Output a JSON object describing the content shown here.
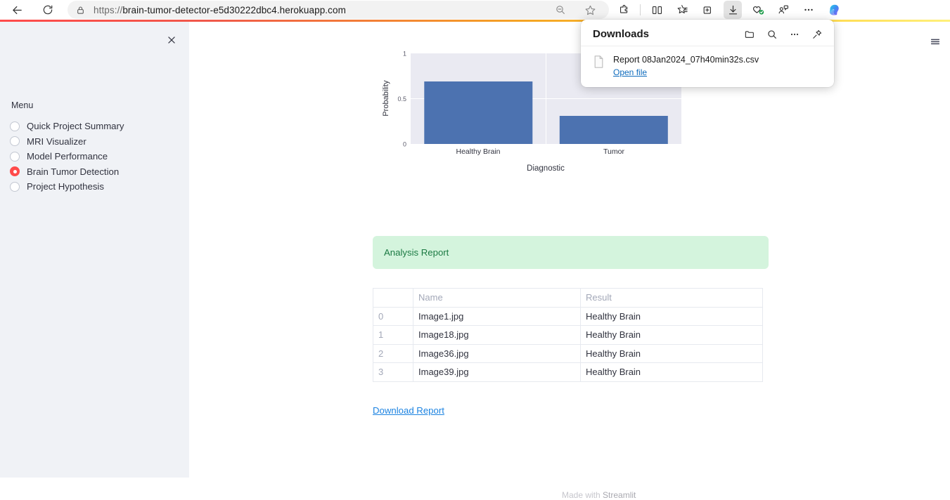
{
  "browser": {
    "url_scheme": "https://",
    "url_rest": "brain-tumor-detector-e5d30222dbc4.herokuapp.com",
    "url_full": "https://brain-tumor-detector-e5d30222dbc4.herokuapp.com",
    "back_icon": "back-arrow-icon",
    "reload_icon": "reload-icon",
    "lock_icon": "lock-icon",
    "toolbar_icons": [
      "zoom-out-icon",
      "favorite-star-icon",
      "extensions-puzzle-icon",
      "split-screen-icon",
      "collections-icon",
      "browser-essentials-icon",
      "downloads-icon",
      "shopping-icon",
      "profile-icon",
      "settings-ellipsis-icon",
      "copilot-icon"
    ]
  },
  "downloads": {
    "title": "Downloads",
    "header_icons": [
      "open-folder-icon",
      "search-icon",
      "more-options-icon",
      "pin-icon"
    ],
    "item": {
      "filename": "Report 08Jan2024_07h40min32s.csv",
      "action_label": "Open file",
      "file_icon": "csv-file-icon"
    }
  },
  "sidebar": {
    "close_icon": "close-icon",
    "menu_label": "Menu",
    "items": [
      {
        "label": "Quick Project Summary",
        "selected": false
      },
      {
        "label": "MRI Visualizer",
        "selected": false
      },
      {
        "label": "Model Performance",
        "selected": false
      },
      {
        "label": "Brain Tumor Detection",
        "selected": true
      },
      {
        "label": "Project Hypothesis",
        "selected": false
      }
    ],
    "accent_color": "#ff4b4b",
    "background_color": "#f0f2f6"
  },
  "main": {
    "app_menu_icon": "hamburger-menu-icon",
    "analysis_report_label": "Analysis Report",
    "analysis_report_bg": "#d4f4dd",
    "analysis_report_fg": "#1b7a43",
    "download_report_label": "Download Report",
    "download_report_color": "#1c83e1",
    "table": {
      "columns": [
        "",
        "Name",
        "Result"
      ],
      "rows": [
        {
          "index": "0",
          "name": "Image1.jpg",
          "result": "Healthy Brain"
        },
        {
          "index": "1",
          "name": "Image18.jpg",
          "result": "Healthy Brain"
        },
        {
          "index": "2",
          "name": "Image36.jpg",
          "result": "Healthy Brain"
        },
        {
          "index": "3",
          "name": "Image39.jpg",
          "result": "Healthy Brain"
        }
      ]
    }
  },
  "footer": {
    "made_with": "Made with ",
    "brand": "Streamlit"
  },
  "chart_data": {
    "type": "bar",
    "title": "",
    "categories": [
      "Healthy Brain",
      "Tumor"
    ],
    "values": [
      0.69,
      0.31
    ],
    "xlabel": "Diagnostic",
    "ylabel": "Probability",
    "ylim": [
      0,
      1
    ],
    "yticks": [
      "0",
      "0.5",
      "1"
    ],
    "ytick_values": [
      0,
      0.5,
      1
    ],
    "bar_color": "#4c72b0",
    "plot_bg": "#eaeaf2",
    "grid": true,
    "grid_color": "#ffffff",
    "legend": "none"
  }
}
